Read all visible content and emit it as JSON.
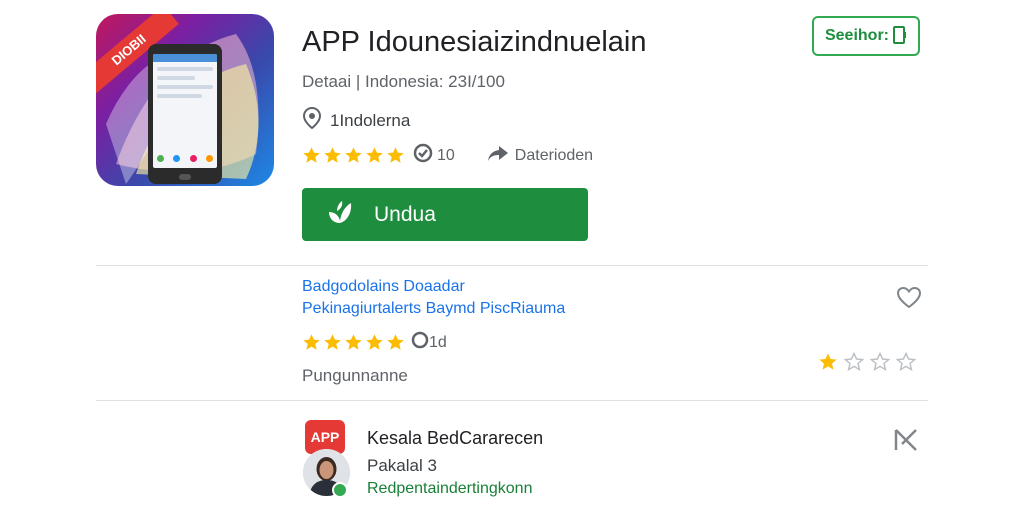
{
  "app": {
    "title": "APP Idounesiaizindnuelain",
    "subtitle": "Detaai | Indonesia: 23I/100",
    "location": "1Indolerna",
    "rating_count": "10",
    "share_label": "Daterioden",
    "install_label": "Undua",
    "icon_ribbon": "DIOBII",
    "icon": "app-icon",
    "stars_filled": 5,
    "stars_total": 5
  },
  "header": {
    "search_label": "Seeihor:",
    "search_icon": "battery-icon"
  },
  "review": {
    "title_line1": "Badgodolains Doaadar",
    "title_line2": "Pekinagiurtalerts Baymd PiscRiauma",
    "rating_count": "1d",
    "stars_filled": 5,
    "author": "Pungunnanne",
    "user_rating": 1,
    "user_rating_total": 4
  },
  "developer": {
    "icon_text": "APP",
    "name": "Kesala BedCararecen",
    "meta": "Pakalal 3",
    "link": "Redpentaindertingkonn"
  },
  "colors": {
    "accent_green": "#1e8e3e",
    "star": "#fbbc04",
    "link_blue": "#1a73e8",
    "brand_red": "#e53935"
  }
}
